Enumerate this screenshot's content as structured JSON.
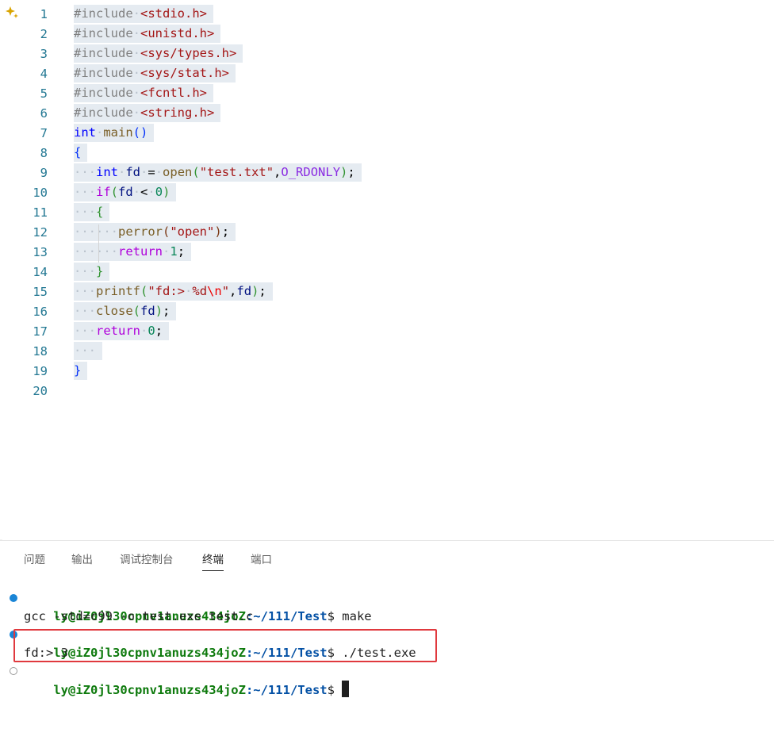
{
  "editor": {
    "lines": [
      {
        "n": "1",
        "tokens": [
          [
            "pp",
            "#include"
          ],
          [
            "ws",
            "·"
          ],
          [
            "inc",
            "<stdio.h>"
          ]
        ]
      },
      {
        "n": "2",
        "tokens": [
          [
            "pp",
            "#include"
          ],
          [
            "ws",
            "·"
          ],
          [
            "inc",
            "<unistd.h>"
          ]
        ]
      },
      {
        "n": "3",
        "tokens": [
          [
            "pp",
            "#include"
          ],
          [
            "ws",
            "·"
          ],
          [
            "inc",
            "<sys/types.h>"
          ]
        ]
      },
      {
        "n": "4",
        "tokens": [
          [
            "pp",
            "#include"
          ],
          [
            "ws",
            "·"
          ],
          [
            "inc",
            "<sys/stat.h>"
          ]
        ]
      },
      {
        "n": "5",
        "tokens": [
          [
            "pp",
            "#include"
          ],
          [
            "ws",
            "·"
          ],
          [
            "inc",
            "<fcntl.h>"
          ]
        ]
      },
      {
        "n": "6",
        "tokens": [
          [
            "pp",
            "#include"
          ],
          [
            "ws",
            "·"
          ],
          [
            "inc",
            "<string.h>"
          ]
        ]
      },
      {
        "n": "7",
        "tokens": [
          [
            "kw",
            "int"
          ],
          [
            "ws",
            "·"
          ],
          [
            "fn",
            "main"
          ],
          [
            "br1",
            "()"
          ]
        ]
      },
      {
        "n": "8",
        "tokens": [
          [
            "br1",
            "{"
          ]
        ]
      },
      {
        "n": "9",
        "tokens": [
          [
            "ws",
            "···"
          ],
          [
            "kw",
            "int"
          ],
          [
            "ws",
            "·"
          ],
          [
            "var",
            "fd"
          ],
          [
            "ws",
            "·"
          ],
          [
            "plain",
            "="
          ],
          [
            "ws",
            "·"
          ],
          [
            "fn",
            "open"
          ],
          [
            "br2",
            "("
          ],
          [
            "str",
            "\"test.txt\""
          ],
          [
            "plain",
            ","
          ],
          [
            "const",
            "O_RDONLY"
          ],
          [
            "br2",
            ")"
          ],
          [
            "plain",
            ";"
          ]
        ]
      },
      {
        "n": "10",
        "tokens": [
          [
            "ws",
            "···"
          ],
          [
            "ctl",
            "if"
          ],
          [
            "br2",
            "("
          ],
          [
            "var",
            "fd"
          ],
          [
            "ws",
            "·"
          ],
          [
            "plain",
            "<"
          ],
          [
            "ws",
            "·"
          ],
          [
            "num",
            "0"
          ],
          [
            "br2",
            ")"
          ]
        ]
      },
      {
        "n": "11",
        "tokens": [
          [
            "ws",
            "···"
          ],
          [
            "br2",
            "{"
          ]
        ]
      },
      {
        "n": "12",
        "tokens": [
          [
            "ws",
            "······"
          ],
          [
            "fn",
            "perror"
          ],
          [
            "br3",
            "("
          ],
          [
            "str",
            "\"open\""
          ],
          [
            "br3",
            ")"
          ],
          [
            "plain",
            ";"
          ]
        ]
      },
      {
        "n": "13",
        "tokens": [
          [
            "ws",
            "······"
          ],
          [
            "ctl",
            "return"
          ],
          [
            "ws",
            "·"
          ],
          [
            "num",
            "1"
          ],
          [
            "plain",
            ";"
          ]
        ]
      },
      {
        "n": "14",
        "tokens": [
          [
            "ws",
            "···"
          ],
          [
            "br2",
            "}"
          ]
        ]
      },
      {
        "n": "15",
        "tokens": [
          [
            "ws",
            "···"
          ],
          [
            "fn",
            "printf"
          ],
          [
            "br2",
            "("
          ],
          [
            "str",
            "\"fd:>"
          ],
          [
            "ws",
            "·"
          ],
          [
            "str",
            "%d"
          ],
          [
            "esc",
            "\\n"
          ],
          [
            "str",
            "\""
          ],
          [
            "plain",
            ","
          ],
          [
            "var",
            "fd"
          ],
          [
            "br2",
            ")"
          ],
          [
            "plain",
            ";"
          ]
        ]
      },
      {
        "n": "16",
        "tokens": [
          [
            "ws",
            "···"
          ],
          [
            "fn",
            "close"
          ],
          [
            "br2",
            "("
          ],
          [
            "var",
            "fd"
          ],
          [
            "br2",
            ")"
          ],
          [
            "plain",
            ";"
          ]
        ]
      },
      {
        "n": "17",
        "tokens": [
          [
            "ws",
            "···"
          ],
          [
            "ctl",
            "return"
          ],
          [
            "ws",
            "·"
          ],
          [
            "num",
            "0"
          ],
          [
            "plain",
            ";"
          ]
        ]
      },
      {
        "n": "18",
        "tokens": [
          [
            "ws",
            "···"
          ]
        ]
      },
      {
        "n": "19",
        "tokens": [
          [
            "br1",
            "}"
          ]
        ]
      },
      {
        "n": "20",
        "tokens": []
      }
    ]
  },
  "panel": {
    "tabs": [
      {
        "label": "问题",
        "active": false
      },
      {
        "label": "输出",
        "active": false
      },
      {
        "label": "调试控制台",
        "active": false
      },
      {
        "label": "终端",
        "active": true
      },
      {
        "label": "端口",
        "active": false
      }
    ]
  },
  "terminal": {
    "user_host": "ly@iZ0jl30cpnv1anuzs434joZ",
    "path": ":~/111/Test",
    "prompt_symbol": "$",
    "cmd1": " make",
    "output1": "gcc -std=c99 -o test.exe test.c",
    "cmd2": " ./test.exe",
    "output2": "fd:> 3",
    "cmd3": " "
  },
  "colors": {
    "accent": "#1a85d6",
    "highlight_box": "#e0393e",
    "user": "#0e7a0d",
    "path": "#0451a5"
  },
  "icons": {
    "sparkle": "sparkle-icon"
  }
}
